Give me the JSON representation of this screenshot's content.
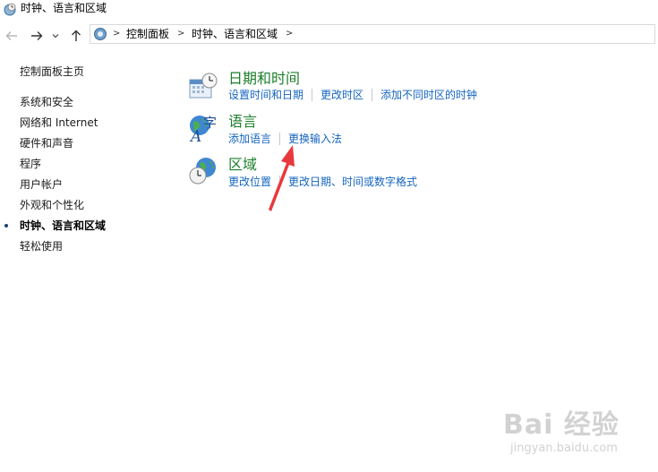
{
  "window": {
    "title": "时钟、语言和区域"
  },
  "address_bar": {
    "crumbs": [
      "控制面板",
      "时钟、语言和区域"
    ],
    "separator": ">"
  },
  "sidebar": {
    "home": "控制面板主页",
    "items": [
      {
        "label": "系统和安全",
        "active": false
      },
      {
        "label": "网络和 Internet",
        "active": false
      },
      {
        "label": "硬件和声音",
        "active": false
      },
      {
        "label": "程序",
        "active": false
      },
      {
        "label": "用户帐户",
        "active": false
      },
      {
        "label": "外观和个性化",
        "active": false
      },
      {
        "label": "时钟、语言和区域",
        "active": true
      },
      {
        "label": "轻松使用",
        "active": false
      }
    ]
  },
  "categories": [
    {
      "title": "日期和时间",
      "icon": "calendar-clock-icon",
      "links": [
        "设置时间和日期",
        "更改时区",
        "添加不同时区的时钟"
      ]
    },
    {
      "title": "语言",
      "icon": "language-globe-icon",
      "links": [
        "添加语言",
        "更换输入法"
      ]
    },
    {
      "title": "区域",
      "icon": "region-globe-clock-icon",
      "links": [
        "更改位置",
        "更改日期、时间或数字格式"
      ]
    }
  ],
  "annotation": {
    "arrow_color": "#e8393d"
  },
  "watermark": {
    "main": "Bai 经验",
    "sub": "jingyan.baidu.com"
  },
  "colors": {
    "link": "#1565c0",
    "category_title": "#1c7f2b"
  }
}
